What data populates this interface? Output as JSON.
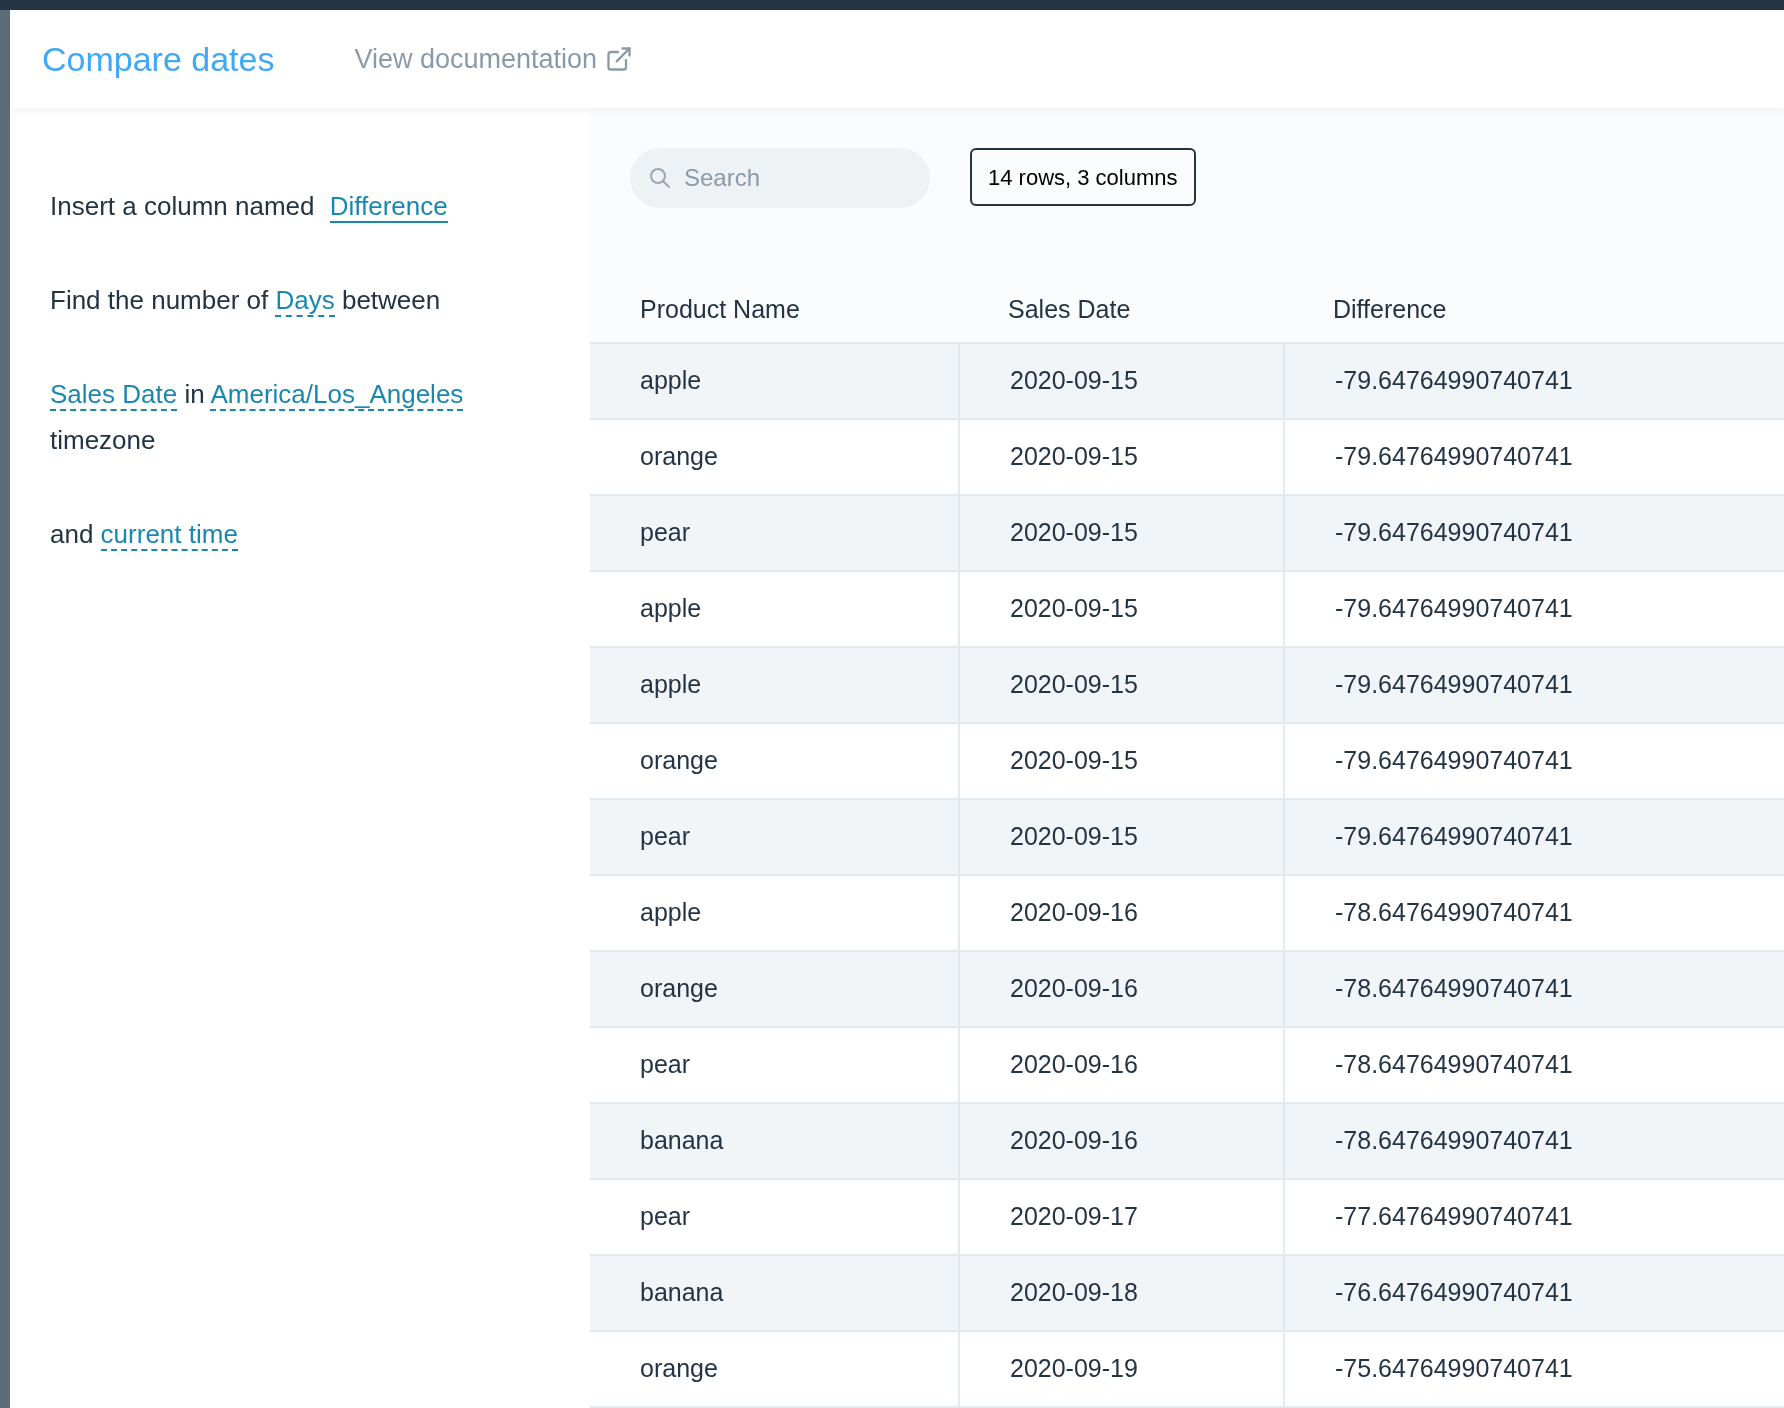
{
  "header": {
    "title": "Compare dates",
    "doc_link": "View documentation"
  },
  "instructions": [
    {
      "parts": [
        {
          "kind": "plain",
          "text": "Insert a column named "
        },
        {
          "kind": "field",
          "text": "Difference"
        }
      ]
    },
    {
      "parts": [
        {
          "kind": "plain",
          "text": "Find the number of "
        },
        {
          "kind": "option",
          "text": "Days"
        },
        {
          "kind": "plain",
          "text": " between"
        }
      ]
    },
    {
      "parts": [
        {
          "kind": "option",
          "text": "Sales Date"
        },
        {
          "kind": "plain",
          "text": " in "
        },
        {
          "kind": "option",
          "text": "America/Los_Angeles"
        },
        {
          "kind": "plain",
          "text": " timezone"
        }
      ]
    },
    {
      "parts": [
        {
          "kind": "plain",
          "text": "and "
        },
        {
          "kind": "option",
          "text": "current time"
        }
      ]
    }
  ],
  "search": {
    "placeholder": "Search"
  },
  "summary": "14 rows, 3 columns",
  "table": {
    "columns": [
      "Product Name",
      "Sales Date",
      "Difference"
    ],
    "rows": [
      [
        "apple",
        "2020-09-15",
        "-79.64764990740741"
      ],
      [
        "orange",
        "2020-09-15",
        "-79.64764990740741"
      ],
      [
        "pear",
        "2020-09-15",
        "-79.64764990740741"
      ],
      [
        "apple",
        "2020-09-15",
        "-79.64764990740741"
      ],
      [
        "apple",
        "2020-09-15",
        "-79.64764990740741"
      ],
      [
        "orange",
        "2020-09-15",
        "-79.64764990740741"
      ],
      [
        "pear",
        "2020-09-15",
        "-79.64764990740741"
      ],
      [
        "apple",
        "2020-09-16",
        "-78.64764990740741"
      ],
      [
        "orange",
        "2020-09-16",
        "-78.64764990740741"
      ],
      [
        "pear",
        "2020-09-16",
        "-78.64764990740741"
      ],
      [
        "banana",
        "2020-09-16",
        "-78.64764990740741"
      ],
      [
        "pear",
        "2020-09-17",
        "-77.64764990740741"
      ],
      [
        "banana",
        "2020-09-18",
        "-76.64764990740741"
      ],
      [
        "orange",
        "2020-09-19",
        "-75.64764990740741"
      ]
    ]
  }
}
